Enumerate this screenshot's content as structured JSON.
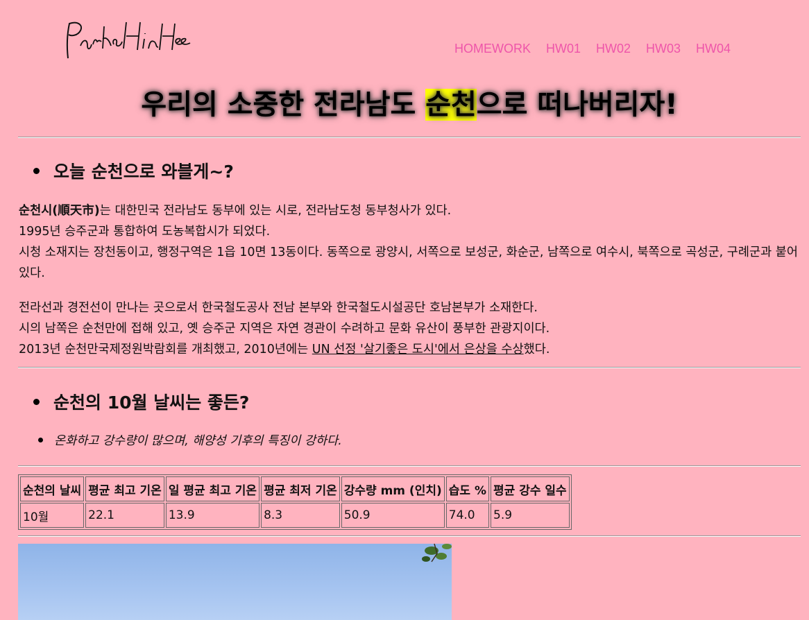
{
  "logo_text": "ParkSHinHee",
  "nav": [
    "HOMEWORK",
    "HW01",
    "HW02",
    "HW03",
    "HW04"
  ],
  "title": {
    "before": "우리의 소중한 전라남도 ",
    "highlight": "순천",
    "after": "으로 떠나버리자!"
  },
  "section1": {
    "heading": "오늘 순천으로 와블게~?",
    "para1": {
      "bold": "순천시(順天市)",
      "line1_rest": "는 대한민국 전라남도 동부에 있는 시로, 전라남도청 동부청사가 있다.",
      "line2": "1995년 승주군과 통합하여 도농복합시가 되었다.",
      "line3": "시청 소재지는 장천동이고, 행정구역은 1읍 10면 13동이다. 동쪽으로 광양시, 서쪽으로 보성군, 화순군, 남쪽으로 여수시, 북쪽으로 곡성군, 구례군과 붙어 있다."
    },
    "para2": {
      "line1": "전라선과 경전선이 만나는 곳으로서 한국철도공사 전남 본부와 한국철도시설공단 호남본부가 소재한다.",
      "line2": "시의 남쪽은 순천만에 접해 있고, 옛 승주군 지역은 자연 경관이 수려하고 문화 유산이 풍부한 관광지이다.",
      "line3_start": "2013년 순천만국제정원박람회를 개최했고, 2010년에는 ",
      "line3_link": "UN 선정 '살기좋은 도시'에서 은상을 수상",
      "line3_end": "했다."
    }
  },
  "section2": {
    "heading": "순천의 10월 날씨는 좋든?",
    "item": "온화하고 강수량이 많으며, 해양성 기후의 특징이 강하다."
  },
  "table": {
    "headers": [
      "순천의 날씨",
      "평균 최고 기온",
      "일 평균 최고 기온",
      "평균 최저 기온",
      "강수량 mm (인치)",
      "습도 %",
      "평균 강수 일수"
    ],
    "row": [
      "10월",
      "22.1",
      "13.9",
      "8.3",
      "50.9",
      "74.0",
      "5.9"
    ]
  },
  "colors": {
    "background": "#ffb3bf",
    "nav": "#ee55aa",
    "highlight": "#ffff00"
  }
}
